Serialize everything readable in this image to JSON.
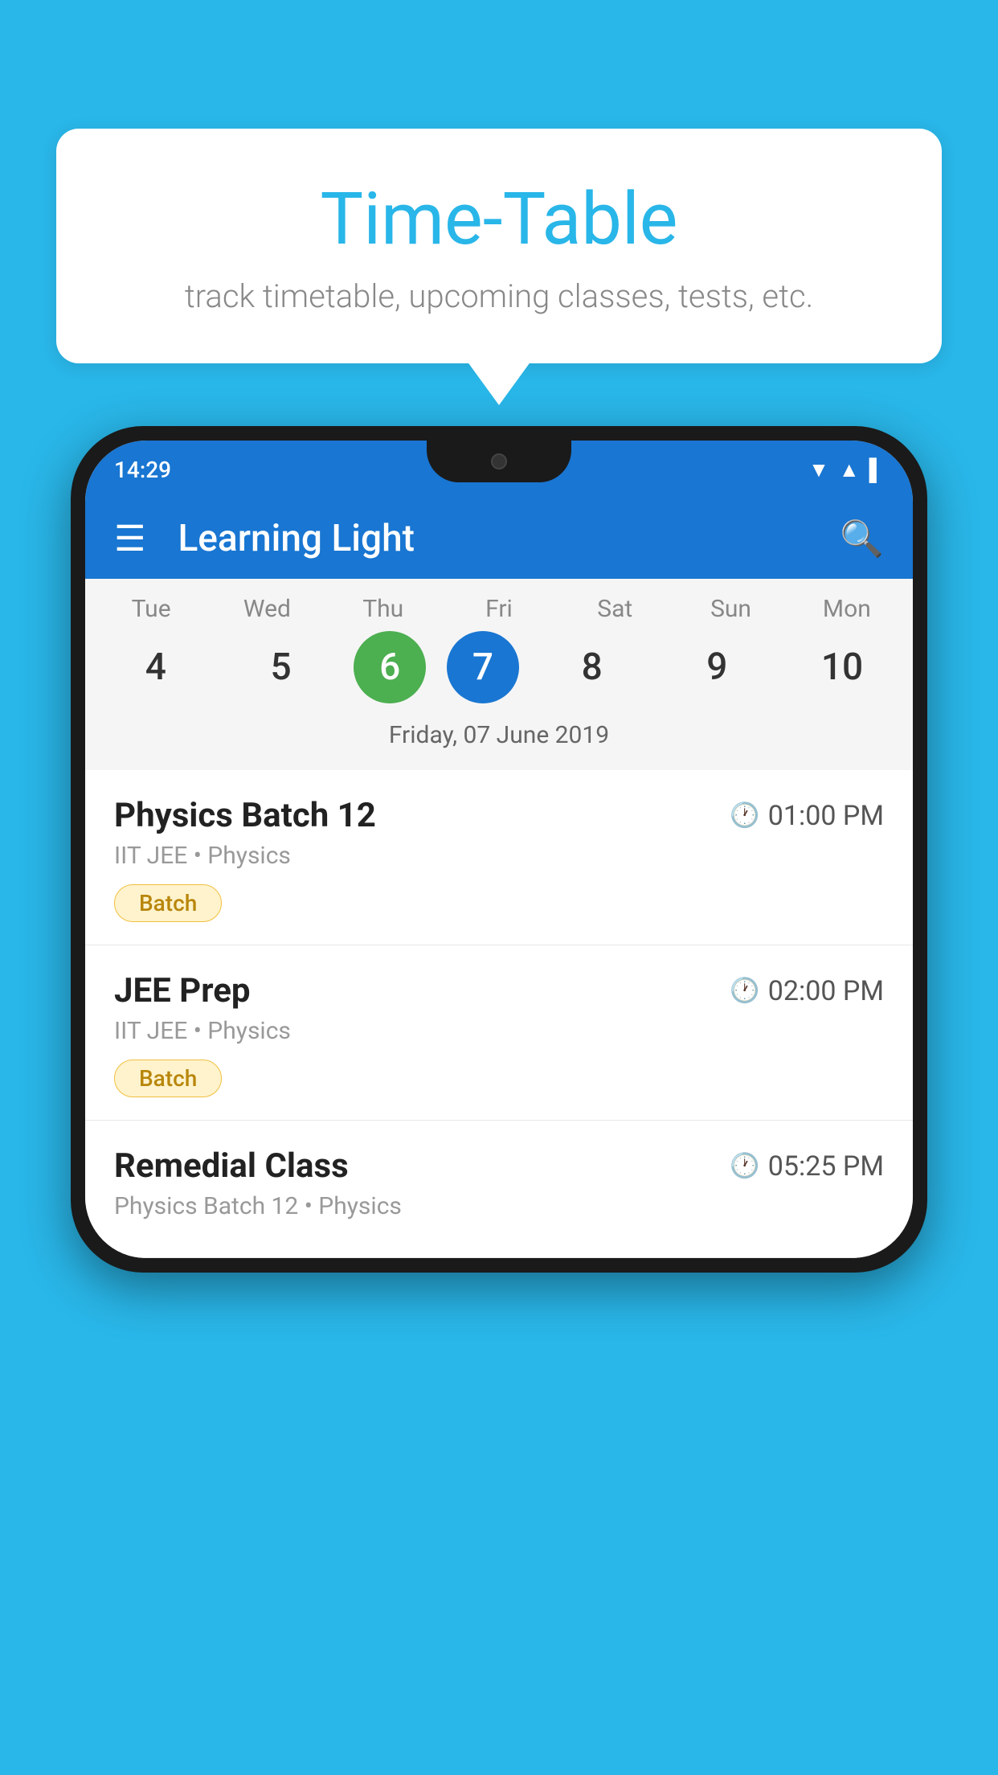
{
  "background_color": "#29b6e8",
  "speech_bubble": {
    "title": "Time-Table",
    "subtitle": "track timetable, upcoming classes, tests, etc."
  },
  "status_bar": {
    "time": "14:29",
    "icons": [
      "wifi",
      "signal",
      "battery"
    ]
  },
  "app_bar": {
    "title": "Learning Light",
    "menu_icon": "☰",
    "search_icon": "🔍"
  },
  "calendar": {
    "days": [
      {
        "label": "Tue",
        "number": "4"
      },
      {
        "label": "Wed",
        "number": "5"
      },
      {
        "label": "Thu",
        "number": "6",
        "state": "today"
      },
      {
        "label": "Fri",
        "number": "7",
        "state": "selected"
      },
      {
        "label": "Sat",
        "number": "8"
      },
      {
        "label": "Sun",
        "number": "9"
      },
      {
        "label": "Mon",
        "number": "10"
      }
    ],
    "selected_date_label": "Friday, 07 June 2019"
  },
  "schedule_items": [
    {
      "title": "Physics Batch 12",
      "time": "01:00 PM",
      "subtitle": "IIT JEE • Physics",
      "tag": "Batch"
    },
    {
      "title": "JEE Prep",
      "time": "02:00 PM",
      "subtitle": "IIT JEE • Physics",
      "tag": "Batch"
    },
    {
      "title": "Remedial Class",
      "time": "05:25 PM",
      "subtitle": "Physics Batch 12 • Physics",
      "tag": null
    }
  ]
}
